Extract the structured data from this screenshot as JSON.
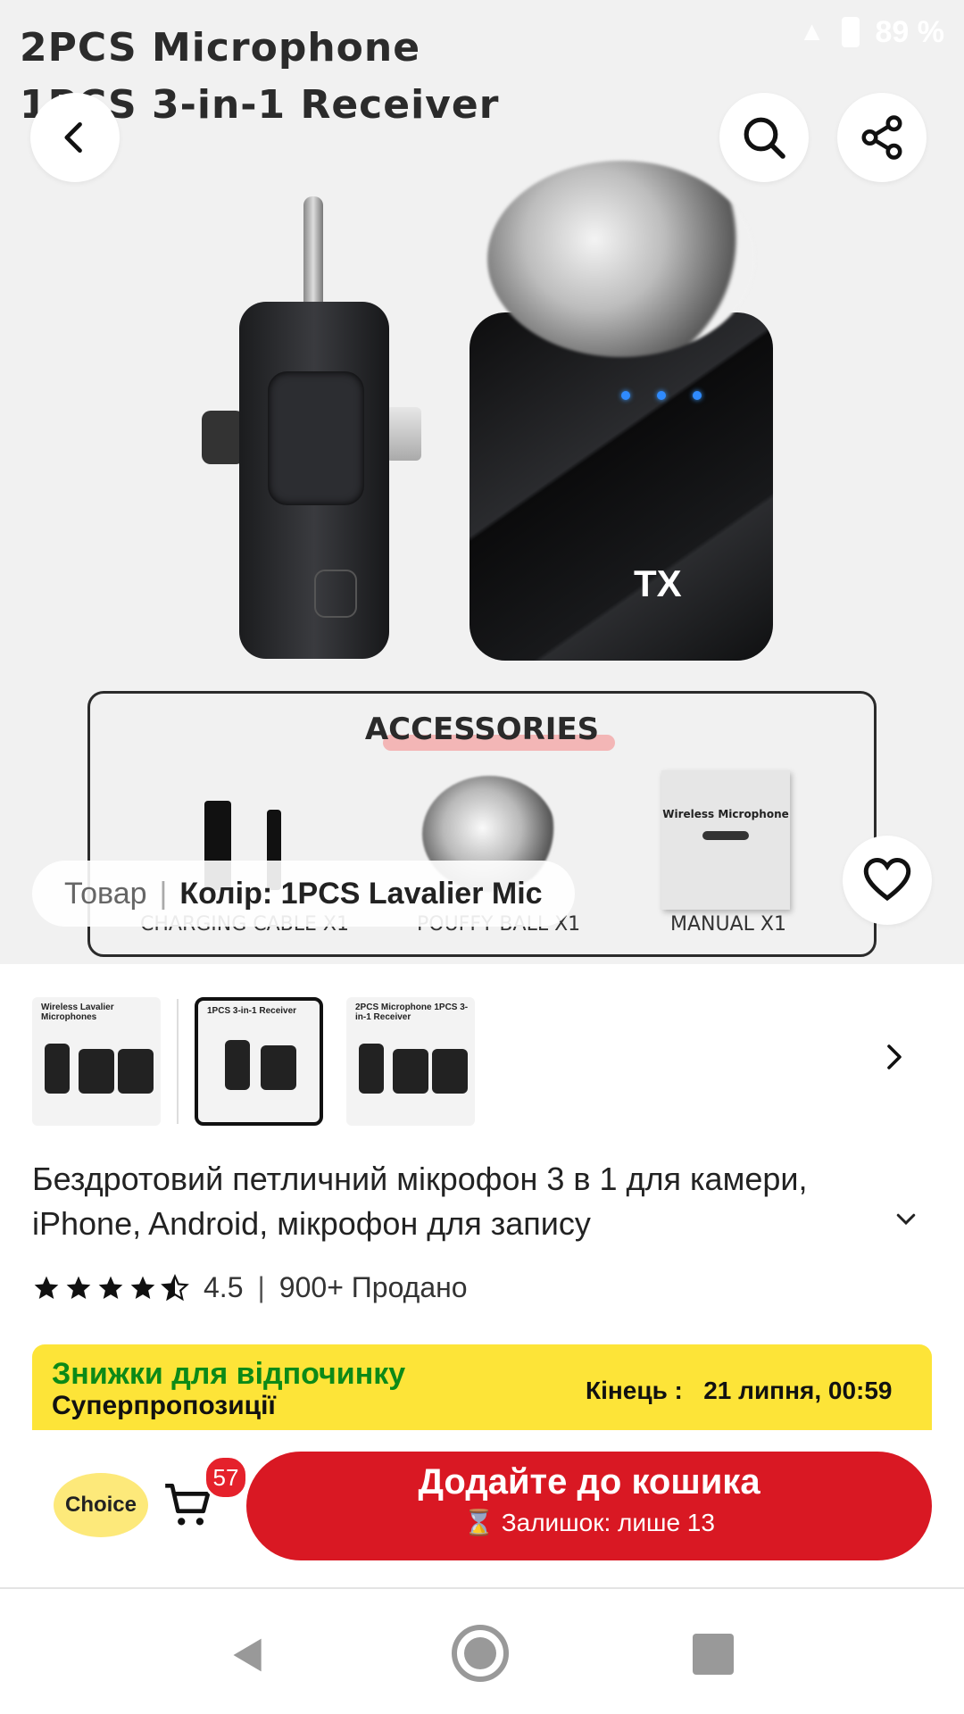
{
  "status": {
    "battery": "89 %"
  },
  "hero": {
    "image_title_line1": "2PCS Microphone",
    "image_title_line2": "1PCS 3-in-1 Receiver",
    "tx_label": "TX",
    "accessories": {
      "title": "ACCESSORIES",
      "items": [
        "CHARGING CABLE X1",
        "POUFFY BALL X1",
        "MANUAL X1"
      ],
      "manual_text": "Wireless Microphone"
    },
    "variant": {
      "label": "Товар",
      "value": "Колір: 1PCS Lavalier Mic"
    }
  },
  "thumbnails": [
    {
      "caption": "Wireless Lavalier Microphones",
      "selected": false
    },
    {
      "caption": "1PCS 3-in-1 Receiver",
      "selected": true
    },
    {
      "caption": "2PCS Microphone 1PCS 3-in-1 Receiver",
      "selected": false
    }
  ],
  "product": {
    "title": "Бездротовий петличний мікрофон 3 в 1 для камери, iPhone, Android, мікрофон для запису",
    "rating": "4.5",
    "sold": "900+ Продано"
  },
  "promo": {
    "line1": "Знижки для відпочинку",
    "line2": "Суперпропозиції",
    "end_label": "Кінець :",
    "end_value": "21 липня, 00:59",
    "colors": {
      "background": "#fde438",
      "accent": "#0c8a17"
    }
  },
  "action_bar": {
    "choice_label": "Choice",
    "cart_count": "57",
    "add_to_cart": "Додайте до кошика",
    "stock_note": "Залишок: лише 13",
    "colors": {
      "button": "#d91823"
    }
  }
}
